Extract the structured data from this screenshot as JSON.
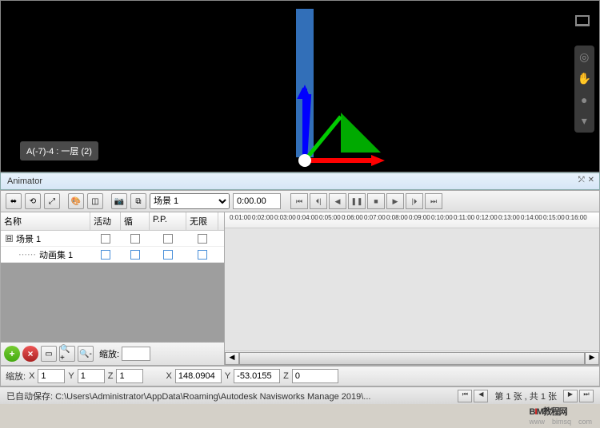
{
  "viewport": {
    "tooltip": "A(-7)-4 : 一层 (2)"
  },
  "panel": {
    "title": "Animator",
    "scene_select": "场景 1",
    "time": "0:00.00"
  },
  "tree": {
    "headers": {
      "name": "名称",
      "active": "活动",
      "loop": "循",
      "pp": "P.P.",
      "infinite": "无限"
    },
    "rows": [
      {
        "name": "场景 1",
        "indent": 0,
        "expand": "⊟",
        "checks": [
          false,
          false,
          false,
          false
        ]
      },
      {
        "name": "动画集 1",
        "indent": 1,
        "expand": "",
        "checks": [
          true,
          true,
          true,
          true
        ]
      }
    ],
    "zoom_label": "缩放:"
  },
  "timeline": {
    "ticks": [
      "0:01:00",
      "0:02:00",
      "0:03:00",
      "0:04:00",
      "0:05:00",
      "0:06:00",
      "0:07:00",
      "0:08:00",
      "0:09:00",
      "0:10:00",
      "0:11:00",
      "0:12:00",
      "0:13:00",
      "0:14:00",
      "0:15:00",
      "0:16:00"
    ]
  },
  "coords": {
    "scale_label": "缩放:",
    "sx": "1",
    "sy": "1",
    "sz": "1",
    "px": "148.0904",
    "py": "-53.0155",
    "pz": "0"
  },
  "status": {
    "autosave": "已自动保存: C:\\Users\\Administrator\\AppData\\Roaming\\Autodesk Navisworks Manage 2019\\...",
    "page": "第 1 张 , 共 1 张"
  },
  "watermark": {
    "b": "B",
    "i": "I",
    "m": "M",
    "txt": "教程网",
    "sub": "www　bimsq　com"
  }
}
